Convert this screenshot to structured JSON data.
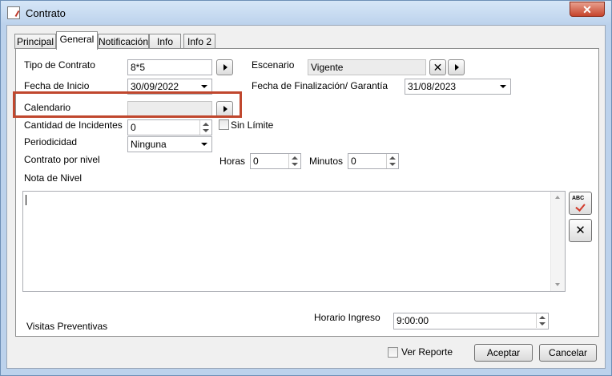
{
  "window": {
    "title": "Contrato"
  },
  "tabs": [
    {
      "label": "Principal"
    },
    {
      "label": "General"
    },
    {
      "label": "Notificación"
    },
    {
      "label": "Info"
    },
    {
      "label": "Info 2"
    }
  ],
  "active_tab": "General",
  "form": {
    "tipo_contrato": {
      "label": "Tipo de Contrato",
      "value": "8*5"
    },
    "escenario": {
      "label": "Escenario",
      "value": "Vigente"
    },
    "fecha_inicio": {
      "label": "Fecha de Inicio",
      "value": "30/09/2022"
    },
    "fecha_fin": {
      "label": "Fecha de Finalización/ Garantía",
      "value": "31/08/2023"
    },
    "calendario": {
      "label": "Calendario",
      "value": ""
    },
    "cantidad_incidentes": {
      "label": "Cantidad de Incidentes",
      "value": "0"
    },
    "sin_limite": {
      "label": "Sin Límite",
      "checked": false
    },
    "periodicidad": {
      "label": "Periodicidad",
      "value": "Ninguna"
    },
    "contrato_por_nivel": {
      "label": "Contrato por nivel"
    },
    "horas": {
      "label": "Horas",
      "value": "0"
    },
    "minutos": {
      "label": "Minutos",
      "value": "0"
    },
    "nota_nivel": {
      "label": "Nota de Nivel",
      "value": ""
    },
    "visitas_preventivas": {
      "label": "Visitas Preventivas"
    },
    "horario_ingreso": {
      "label": "Horario Ingreso",
      "value": "9:00:00"
    }
  },
  "side_buttons": {
    "spellcheck_text": "ABC",
    "clear_glyph": "✕"
  },
  "footer": {
    "ver_reporte": {
      "label": "Ver Reporte",
      "checked": false
    },
    "aceptar": "Aceptar",
    "cancelar": "Cancelar"
  },
  "highlight_color": "#c0472e"
}
